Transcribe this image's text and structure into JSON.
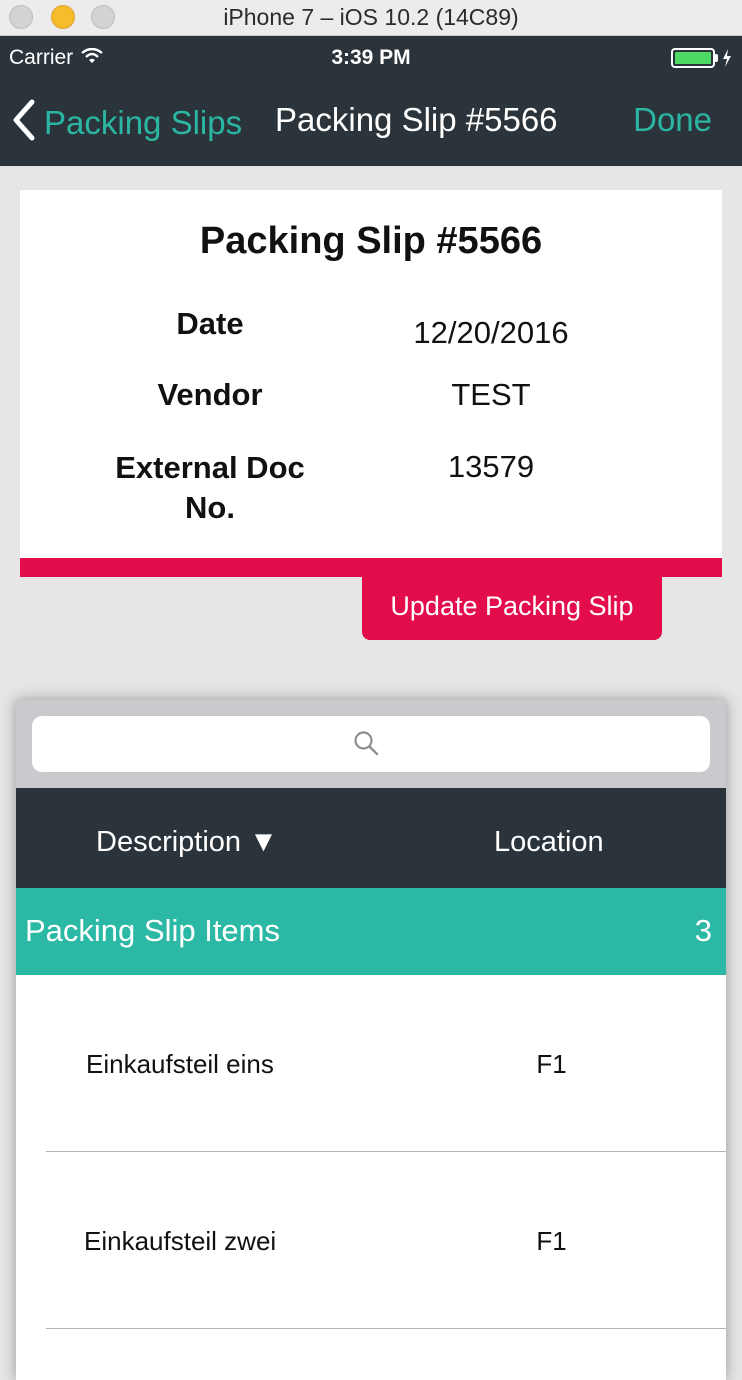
{
  "simulator": {
    "title": "iPhone 7 – iOS 10.2 (14C89)"
  },
  "status_bar": {
    "carrier": "Carrier",
    "time": "3:39 PM"
  },
  "nav": {
    "back_label": "Packing Slips",
    "title": "Packing Slip #5566",
    "done_label": "Done"
  },
  "slip": {
    "title": "Packing Slip #5566",
    "date_label": "Date",
    "date_value": "12/20/2016",
    "vendor_label": "Vendor",
    "vendor_value": "TEST",
    "extdoc_label_line1": "External Doc",
    "extdoc_label_line2": "No.",
    "extdoc_value": "13579",
    "update_button": "Update Packing Slip"
  },
  "list": {
    "search_placeholder": "",
    "columns": {
      "description": "Description ▼",
      "location": "Location"
    },
    "section": {
      "label": "Packing Slip Items",
      "count": "3"
    },
    "rows": [
      {
        "description": "Einkaufsteil eins",
        "location": "F1"
      },
      {
        "description": "Einkaufsteil zwei",
        "location": "F1"
      }
    ]
  },
  "colors": {
    "nav_bg": "#2b343a",
    "accent_teal": "#2bb6a3",
    "section_teal": "#2bb9a5",
    "accent_pink": "#e30d4c"
  }
}
